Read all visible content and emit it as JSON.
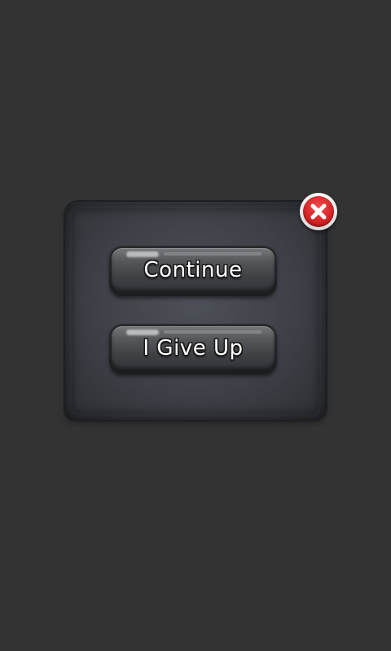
{
  "dialog": {
    "buttons": [
      {
        "label": "Continue"
      },
      {
        "label": "I Give Up"
      }
    ],
    "close_icon": "close-x-icon"
  },
  "colors": {
    "background": "#333333",
    "panel": "#3e4047",
    "button_face": "#56575b",
    "close_red": "#d7262a"
  }
}
